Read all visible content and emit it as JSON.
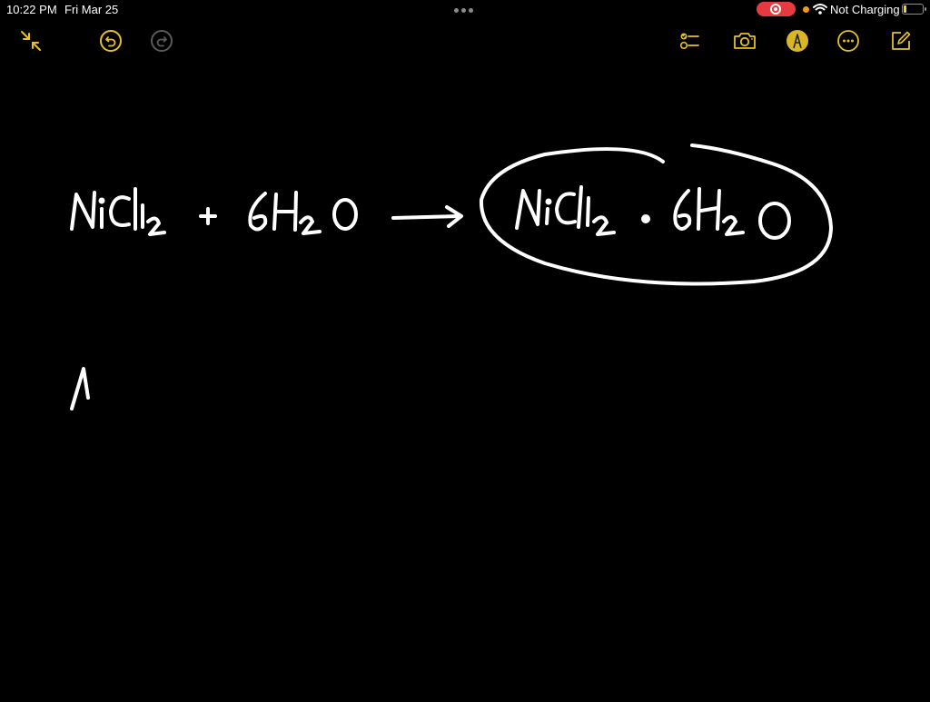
{
  "status_bar": {
    "time": "10:22 PM",
    "date": "Fri Mar 25",
    "recording_indicator": "screen-recording",
    "battery_status": "Not Charging",
    "battery_level_percent": 10
  },
  "toolbar": {
    "left": [
      {
        "name": "collapse",
        "icon": "arrows-in-icon"
      },
      {
        "name": "undo",
        "icon": "undo-icon"
      },
      {
        "name": "redo",
        "icon": "redo-icon",
        "enabled": false
      }
    ],
    "right": [
      {
        "name": "checklist",
        "icon": "checklist-icon"
      },
      {
        "name": "camera",
        "icon": "camera-icon"
      },
      {
        "name": "markup",
        "icon": "pen-tip-icon"
      },
      {
        "name": "more",
        "icon": "ellipsis-icon"
      },
      {
        "name": "new-note",
        "icon": "compose-icon"
      }
    ]
  },
  "colors": {
    "accent": "#e6c02b",
    "background": "#000000",
    "ink": "#ffffff",
    "record": "#e53a40"
  },
  "note": {
    "handwriting": {
      "line1_reactants": "NiCl2 + 6H2O",
      "arrow": "→",
      "line1_product_circled": "NiCl2 · 6H2O",
      "line2": "1"
    }
  }
}
